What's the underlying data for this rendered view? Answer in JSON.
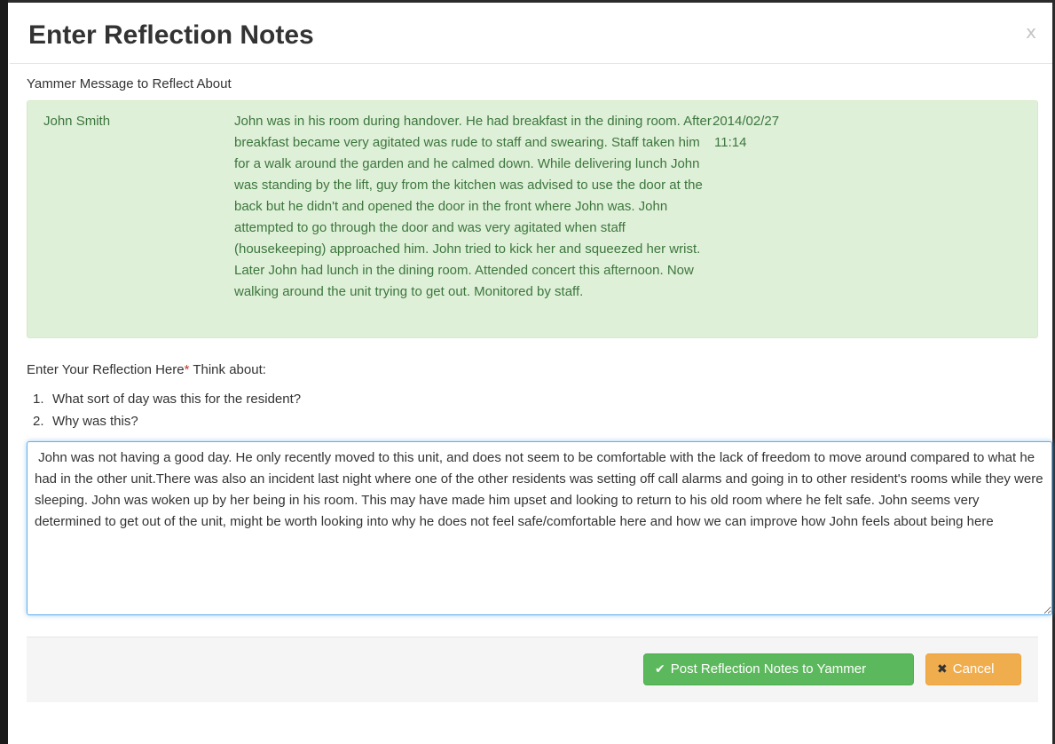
{
  "modal": {
    "title": "Enter Reflection Notes",
    "close_symbol": "x"
  },
  "message_section": {
    "label": "Yammer Message to Reflect About",
    "author": "John Smith",
    "text": "John was in his room during handover. He had breakfast in the dining room. After breakfast became very agitated was rude to staff and swearing. Staff taken him for a walk around the garden and he calmed down. While delivering lunch John was standing by the lift, guy from the kitchen was advised to use the door at the back but he didn't and opened the door in the front where John was. John attempted to go through the door and was very agitated when staff (housekeeping) approached him. John tried to kick her and squeezed her wrist. Later John had lunch in the dining room. Attended concert this afternoon. Now walking around the unit trying to get out. Monitored by staff.",
    "date": "2014/02/27",
    "time": "11:14"
  },
  "reflection": {
    "label": "Enter Your Reflection Here",
    "required_marker": "*",
    "hint": " Think about:",
    "prompts": [
      {
        "num": "1.",
        "text": "What sort of day was this for the resident?"
      },
      {
        "num": "2.",
        "text": "Why was this?"
      }
    ],
    "value": " John was not having a good day. He only recently moved to this unit, and does not seem to be comfortable with the lack of freedom to move around compared to what he had in the other unit.There was also an incident last night where one of the other residents was setting off call alarms and going in to other resident's rooms while they were sleeping. John was woken up by her being in his room. This may have made him upset and looking to return to his old room where he felt safe. John seems very determined to get out of the unit, might be worth looking into why he does not feel safe/comfortable here and how we can improve how John feels about being here"
  },
  "footer": {
    "post_label": "Post Reflection Notes to Yammer",
    "post_icon": "check-icon",
    "cancel_label": "Cancel",
    "cancel_icon": "times-icon"
  },
  "colors": {
    "success_bg": "#dff0d8",
    "success_text": "#3c763d",
    "post_button": "#5cb85c",
    "cancel_button": "#f0ad4e",
    "focus_border": "#66afe9"
  }
}
